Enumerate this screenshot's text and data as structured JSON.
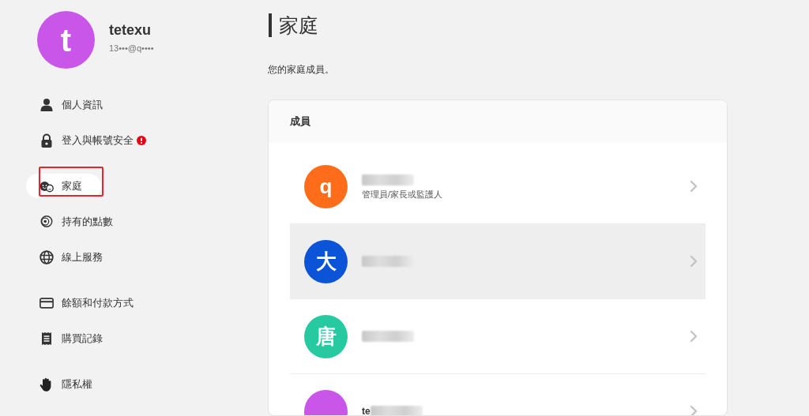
{
  "profile": {
    "initial": "t",
    "color": "#c955e9",
    "username": "tetexu",
    "email": "13•••@q••••"
  },
  "sidebar": {
    "groups": [
      {
        "items": [
          {
            "label": "個人資訊",
            "selected": false,
            "alert": false,
            "annotated": false
          },
          {
            "label": "登入與帳號安全",
            "selected": false,
            "alert": true,
            "annotated": false
          }
        ]
      },
      {
        "items": [
          {
            "label": "家庭",
            "selected": true,
            "alert": false,
            "annotated": true
          },
          {
            "label": "持有的點數",
            "selected": false,
            "alert": false,
            "annotated": false
          },
          {
            "label": "線上服務",
            "selected": false,
            "alert": false,
            "annotated": false
          }
        ]
      },
      {
        "items": [
          {
            "label": "餘額和付款方式",
            "selected": false,
            "alert": false,
            "annotated": false
          },
          {
            "label": "購買記錄",
            "selected": false,
            "alert": false,
            "annotated": false
          }
        ]
      },
      {
        "items": [
          {
            "label": "隱私權",
            "selected": false,
            "alert": false,
            "annotated": false
          }
        ]
      }
    ]
  },
  "page": {
    "title": "家庭",
    "description": "您的家庭成員。"
  },
  "members_card": {
    "heading": "成員",
    "members": [
      {
        "initial": "q",
        "color": "#ff6d1b",
        "name_redacted": true,
        "role": "管理員/家長或監護人",
        "hovered": false
      },
      {
        "initial": "大",
        "color": "#0b54d8",
        "name_redacted": true,
        "hovered": true
      },
      {
        "initial": "唐",
        "color": "#27c9a1",
        "name_redacted": true,
        "hovered": false
      },
      {
        "color": "#c955e9",
        "name_shown": "te",
        "name_redacted": true,
        "hovered": false
      }
    ]
  }
}
